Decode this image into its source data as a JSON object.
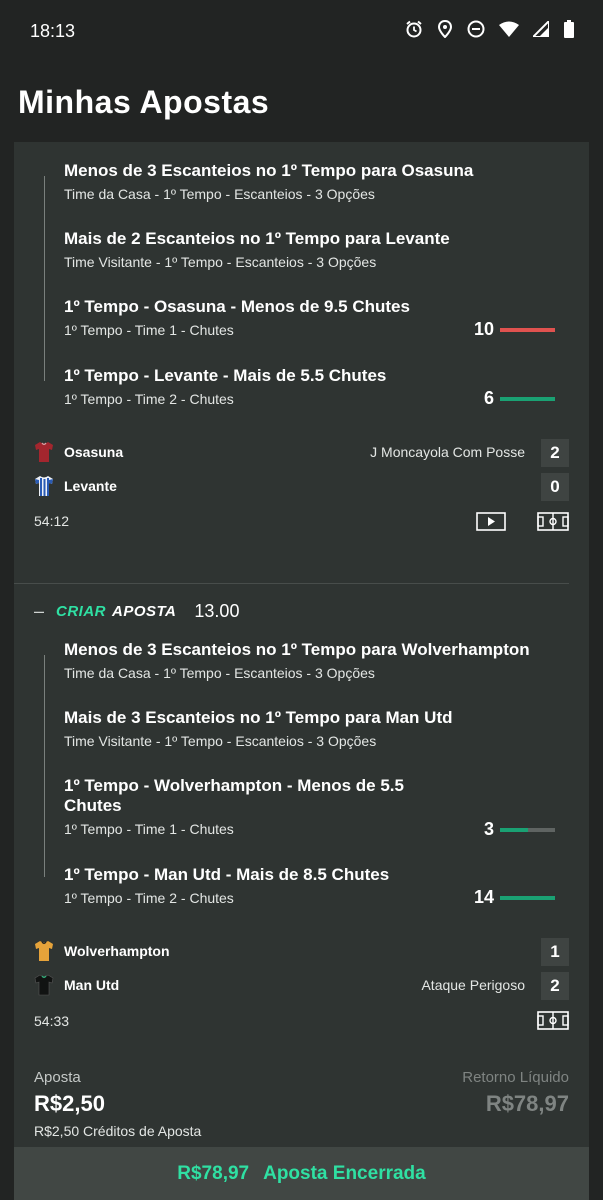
{
  "status_bar": {
    "time": "18:13",
    "icons": [
      "alarm-icon",
      "location-icon",
      "do-not-disturb-icon",
      "wifi-icon",
      "signal-icon",
      "battery-icon"
    ]
  },
  "page": {
    "title": "Minhas Apostas"
  },
  "bet1": {
    "selections": [
      {
        "title": "Menos de 3 Escanteios no 1º Tempo para Osasuna",
        "subtitle": "Time da Casa - 1º Tempo - Escanteios - 3 Opções"
      },
      {
        "title": "Mais de 2 Escanteios no 1º Tempo para Levante",
        "subtitle": "Time Visitante - 1º Tempo - Escanteios - 3 Opções"
      },
      {
        "title": "1º Tempo - Osasuna - Menos de 9.5 Chutes",
        "subtitle": "1º Tempo - Time 1 - Chutes",
        "stat": "10",
        "progress": 1.0,
        "status_color": "#e0524f"
      },
      {
        "title": "1º Tempo - Levante - Mais de 5.5 Chutes",
        "subtitle": "1º Tempo - Time 2 - Chutes",
        "stat": "6",
        "progress": 1.0,
        "status_color": "#1aa173"
      }
    ],
    "home": {
      "name": "Osasuna",
      "score": "2",
      "event": "J Moncayola Com Posse",
      "shirt_color": "#a3262e"
    },
    "away": {
      "name": "Levante",
      "score": "0",
      "event": "",
      "shirt_color": "#2a5bb5"
    },
    "clock": "54:12",
    "icons": [
      "video-icon",
      "pitch-icon"
    ]
  },
  "bet2": {
    "header": {
      "minus": "–",
      "logo_part1": "CRIAR",
      "logo_part2": "APOSTA",
      "odds": "13.00",
      "accent_color": "#2fe0a3"
    },
    "selections": [
      {
        "title": "Menos de 3 Escanteios no 1º Tempo para Wolverhampton",
        "subtitle": "Time da Casa - 1º Tempo - Escanteios - 3 Opções"
      },
      {
        "title": "Mais de 3 Escanteios no 1º Tempo para Man Utd",
        "subtitle": "Time Visitante - 1º Tempo - Escanteios - 3 Opções"
      },
      {
        "title": "1º Tempo - Wolverhampton - Menos de 5.5 Chutes",
        "subtitle": "1º Tempo - Time 1 - Chutes",
        "stat": "3",
        "progress": 0.5,
        "status_color": "#1aa173"
      },
      {
        "title": "1º Tempo - Man Utd - Mais de 8.5 Chutes",
        "subtitle": "1º Tempo - Time 2 - Chutes",
        "stat": "14",
        "progress": 1.0,
        "status_color": "#1aa173"
      }
    ],
    "home": {
      "name": "Wolverhampton",
      "score": "1",
      "event": "",
      "shirt_color": "#e6a33a"
    },
    "away": {
      "name": "Man Utd",
      "score": "2",
      "event": "Ataque Perigoso",
      "shirt_color": "#1b1d1c"
    },
    "clock": "54:33",
    "icons": [
      "pitch-icon"
    ]
  },
  "summary": {
    "stake_label": "Aposta",
    "stake_value": "R$2,50",
    "stake_note": "R$2,50 Créditos de Aposta",
    "return_label": "Retorno Líquido",
    "return_value": "R$78,97"
  },
  "footer": {
    "amount": "R$78,97",
    "status": "Aposta Encerrada"
  }
}
